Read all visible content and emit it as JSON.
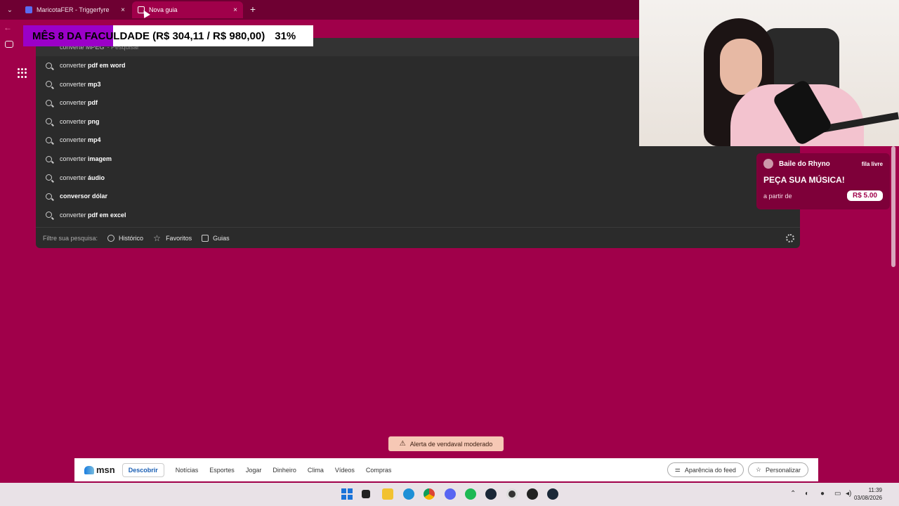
{
  "browser": {
    "tabs": [
      {
        "title": "MaricotaFER - Triggerfyre",
        "active": false
      },
      {
        "title": "Nova guia",
        "active": true
      }
    ],
    "tab_close_glyph": "×",
    "new_tab_glyph": "+"
  },
  "overlay": {
    "goal_text": "MÊS 8 DA FACULDADE (R$ 304,11 / R$ 980,00)",
    "goal_percent": "31%",
    "goal_fraction": 0.31,
    "fill_color": "#9b00c8"
  },
  "search": {
    "query_text": "converte MPEG",
    "query_hint": "- Pesquisar",
    "suggestions": [
      {
        "prefix": "converter",
        "bold": " pdf em word"
      },
      {
        "prefix": "converter",
        "bold": " mp3"
      },
      {
        "prefix": "converter",
        "bold": " pdf"
      },
      {
        "prefix": "converter",
        "bold": " png"
      },
      {
        "prefix": "converter",
        "bold": " mp4"
      },
      {
        "prefix": "converter",
        "bold": " imagem"
      },
      {
        "prefix": "converter",
        "bold": " áudio"
      },
      {
        "prefix": "",
        "bold": "conversor dólar"
      },
      {
        "prefix": "converter",
        "bold": " pdf em excel"
      }
    ],
    "filter_label": "Filtre sua pesquisa:",
    "filters": [
      "Histórico",
      "Favoritos",
      "Guias"
    ]
  },
  "song_widget": {
    "name": "Baile do Rhyno",
    "queue_status": "fila livre",
    "headline": "PEÇA SUA MÚSICA!",
    "price_prefix": "a partir de",
    "price": "R$ 5.00"
  },
  "weather_alert": "Alerta de vendaval moderado",
  "msn": {
    "logo": "msn",
    "nav": [
      "Descobrir",
      "Notícias",
      "Esportes",
      "Jogar",
      "Dinheiro",
      "Clima",
      "Vídeos",
      "Compras"
    ],
    "active_nav": "Descobrir",
    "feed_appearance": "Aparência do feed",
    "personalize": "Personalizar"
  },
  "taskbar": {
    "time": "11:39",
    "date": "03/08/2026"
  },
  "colors": {
    "page_bg": "#a0004a",
    "tabstrip_bg": "#6e0032",
    "dropdown_bg": "#2b2b2b",
    "accent_blue": "#1a5fb4"
  }
}
